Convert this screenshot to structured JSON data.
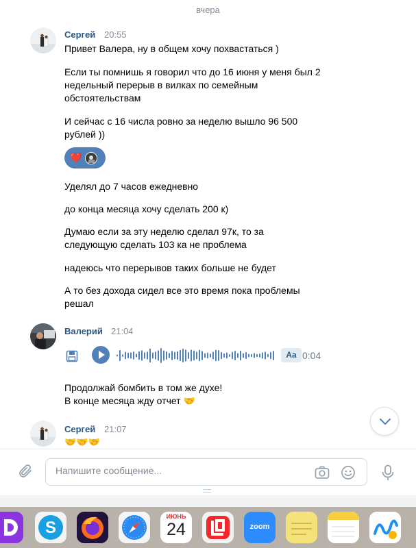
{
  "chat": {
    "date_separator": "вчера",
    "messages": [
      {
        "author": "Сергей",
        "time": "20:55",
        "lines": [
          "Привет Валера, ну в общем хочу похвастаться )",
          "Если ты помнишь я говорил что до 16 июня у меня был 2 недельный перерыв в вилках по семейным обстоятельствам",
          "И сейчас с 16 числа ровно за неделю вышло 96 500 рублей ))",
          "Уделял до 7 часов ежедневно",
          "до конца месяца хочу сделать 200 к)",
          "Думаю если за эту неделю сделал 97к, то за следующую сделать 103 ка не проблема",
          "надеюсь что перерывов таких больше не будет",
          "А то без дохода сидел все это время пока проблемы решал"
        ],
        "reaction": "❤️"
      },
      {
        "author": "Валерий",
        "time": "21:04",
        "voice": {
          "transcribe_label": "Aa",
          "duration": "0:04"
        },
        "lines": [
          "Продолжай бомбить в том же духе!",
          "В конце месяца жду отчет"
        ],
        "emoji": "🤝"
      },
      {
        "author": "Сергей",
        "time": "21:07",
        "emoji": "🤝🤝🤝"
      }
    ]
  },
  "composer": {
    "placeholder": "Напишите сообщение..."
  },
  "dock": {
    "apps": [
      {
        "name": "dock-app-d"
      },
      {
        "name": "skype"
      },
      {
        "name": "firefox"
      },
      {
        "name": "safari"
      },
      {
        "name": "calendar",
        "month": "ИЮНЬ",
        "day": "24"
      },
      {
        "name": "lasso"
      },
      {
        "name": "zoom",
        "label": "zoom"
      },
      {
        "name": "notes-yellow"
      },
      {
        "name": "notes"
      },
      {
        "name": "freeform"
      }
    ]
  },
  "colors": {
    "accent": "#5181b8",
    "author": "#2a5885",
    "muted": "#818c99"
  }
}
